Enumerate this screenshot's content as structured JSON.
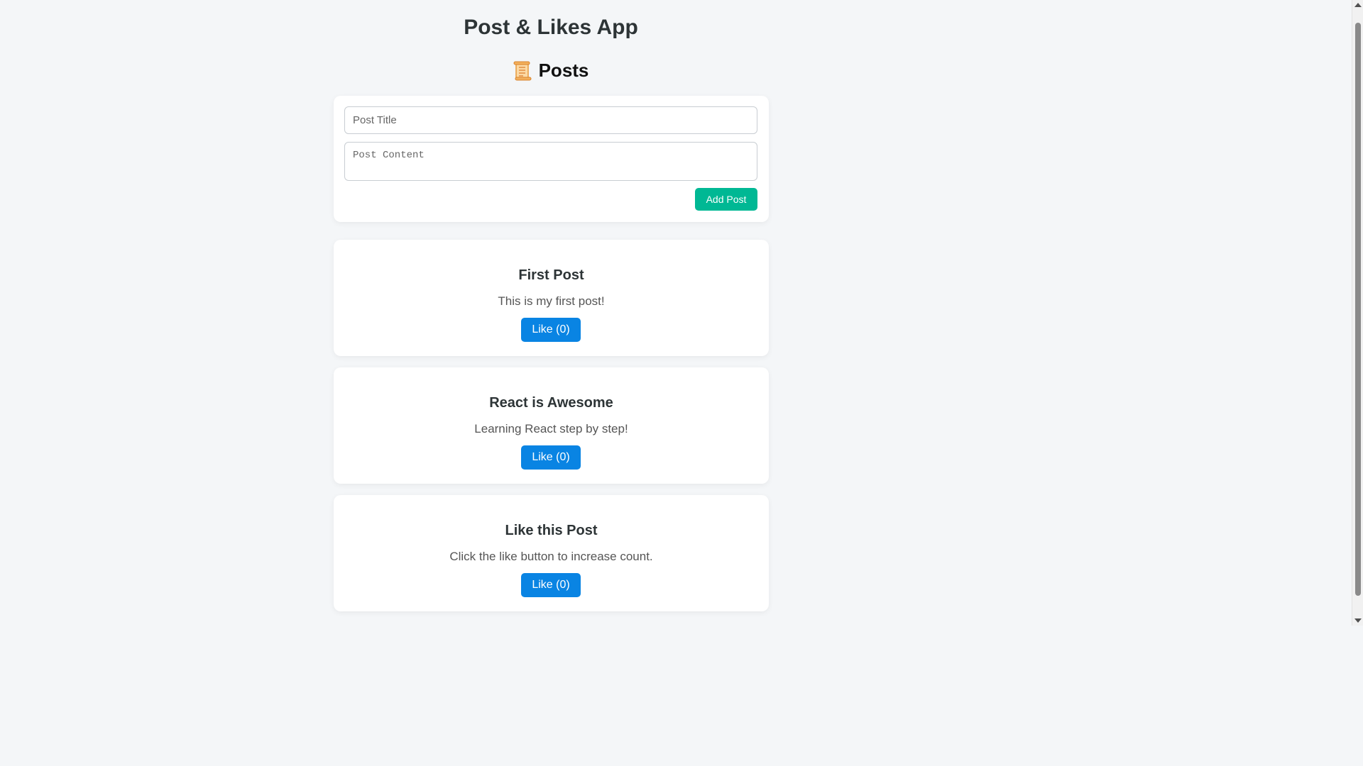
{
  "app": {
    "title": "Post & Likes App"
  },
  "posts_section": {
    "heading": "Posts",
    "icon": "scroll-icon"
  },
  "form": {
    "title_placeholder": "Post Title",
    "title_value": "",
    "content_placeholder": "Post Content",
    "content_value": "",
    "add_label": "Add Post",
    "add_color": "#00b894"
  },
  "posts": [
    {
      "title": "First Post",
      "content": "This is my first post!",
      "like_label": "Like (0)",
      "likes": 0
    },
    {
      "title": "React is Awesome",
      "content": "Learning React step by step!",
      "like_label": "Like (0)",
      "likes": 0
    },
    {
      "title": "Like this Post",
      "content": "Click the like button to increase count.",
      "like_label": "Like (0)",
      "likes": 0
    }
  ],
  "colors": {
    "background": "#f4f6f8",
    "like_button": "#0984e3",
    "card": "#ffffff"
  }
}
